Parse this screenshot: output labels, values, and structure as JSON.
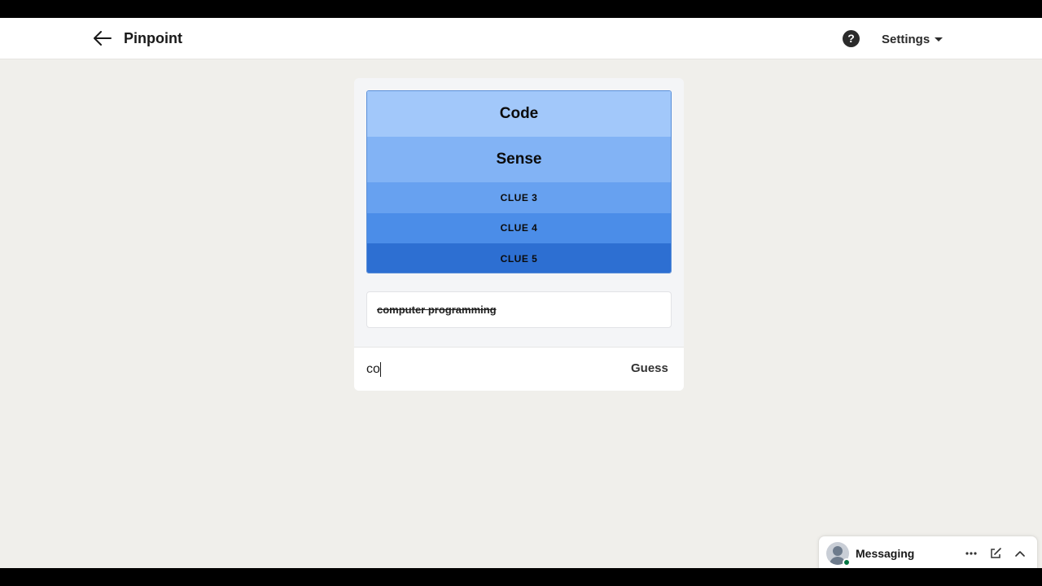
{
  "header": {
    "back_icon": "arrow-left-icon",
    "title": "Pinpoint",
    "help_icon": "question-circle-icon",
    "help_glyph": "?",
    "settings_label": "Settings",
    "settings_icon": "caret-down-icon"
  },
  "clues": [
    {
      "label": "Code",
      "revealed": true,
      "color": "#a2c8fa"
    },
    {
      "label": "Sense",
      "revealed": true,
      "color": "#82b3f5"
    },
    {
      "label": "CLUE 3",
      "revealed": false,
      "color": "#67a1f0"
    },
    {
      "label": "CLUE 4",
      "revealed": false,
      "color": "#4b8de8"
    },
    {
      "label": "CLUE 5",
      "revealed": false,
      "color": "#2d6fd2"
    }
  ],
  "guesses": {
    "wrong": [
      "computer programming"
    ]
  },
  "input": {
    "value": "co",
    "button_label": "Guess"
  },
  "messaging": {
    "label": "Messaging",
    "more_icon": "ellipsis-icon",
    "compose_icon": "compose-icon",
    "collapse_icon": "chevron-up-icon",
    "presence_color": "#057642"
  },
  "colors": {
    "background": "#f0efeb",
    "card": "#f4f5f7"
  }
}
